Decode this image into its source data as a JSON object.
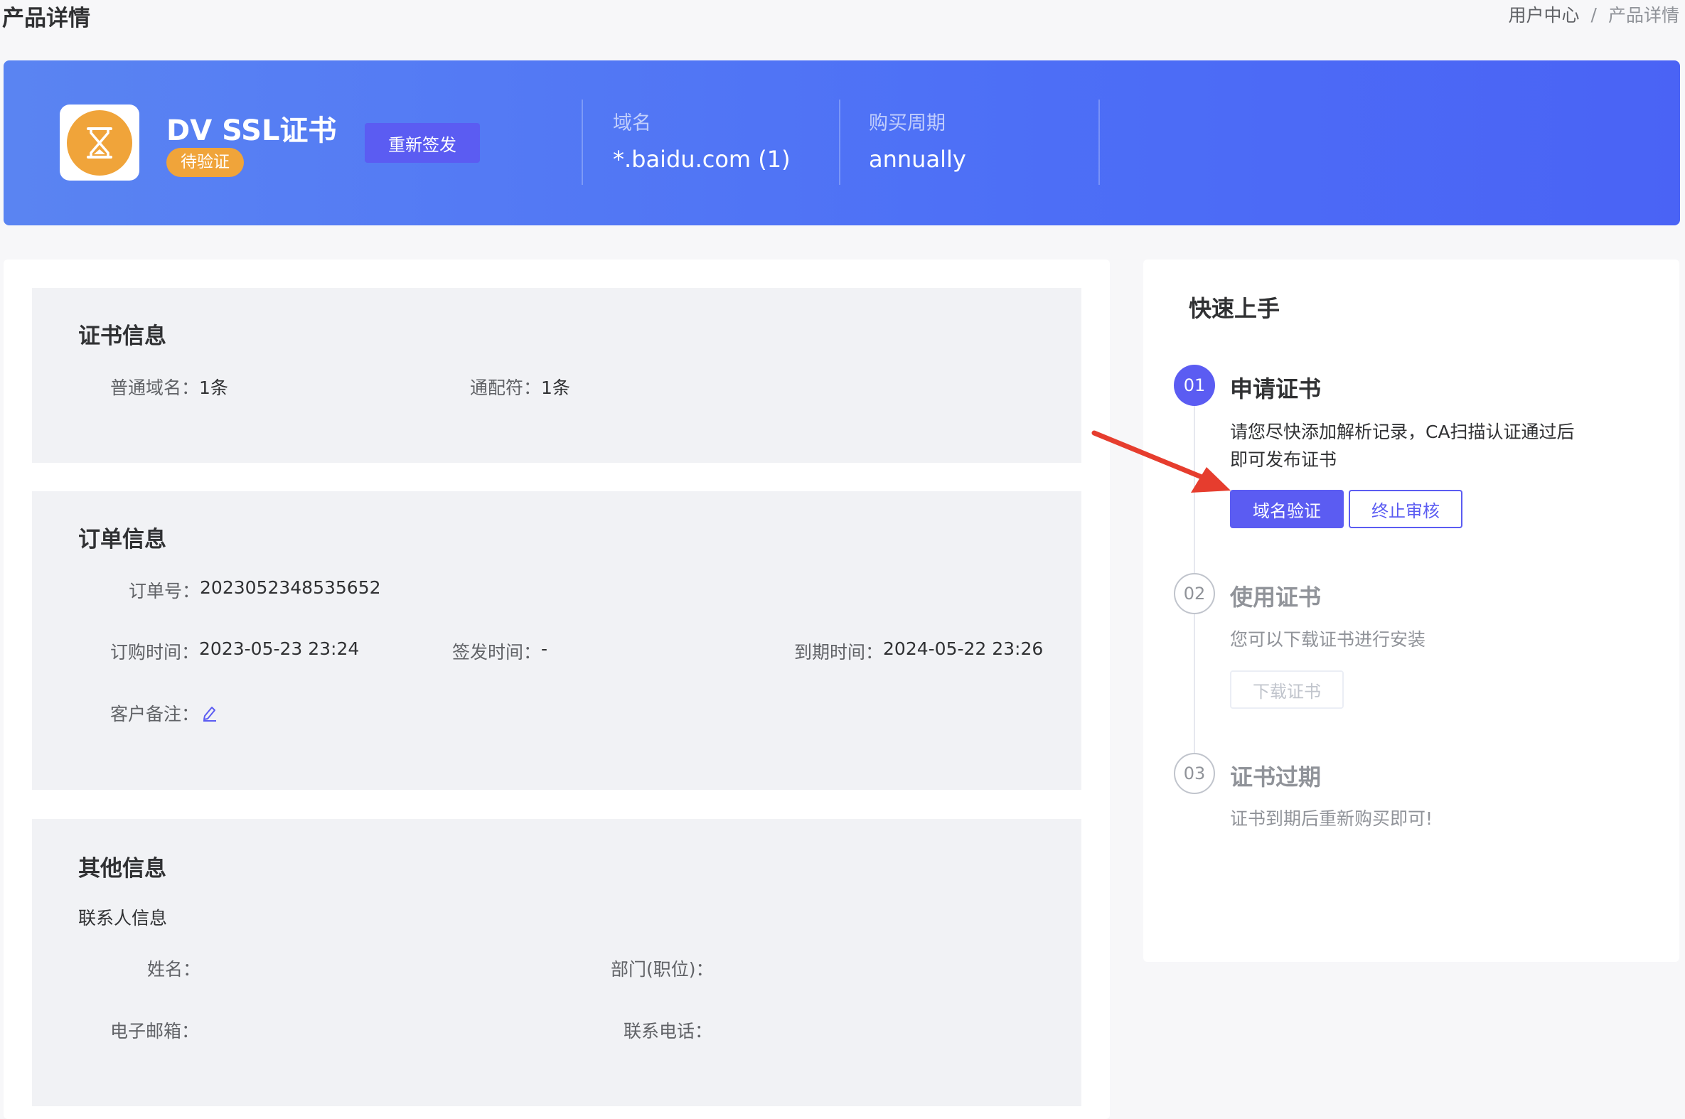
{
  "header": {
    "page_title": "产品详情",
    "breadcrumb": [
      "用户中心",
      "产品详情"
    ],
    "breadcrumb_separator": "/"
  },
  "banner": {
    "icon": "hourglass-icon",
    "product_name": "DV SSL证书",
    "status": "待验证",
    "reissue_button": "重新签发",
    "domain_label": "域名",
    "domain_value": "*.baidu.com (1)",
    "period_label": "购买周期",
    "period_value": "annually",
    "colors": {
      "banner_start": "#5a84f2",
      "banner_end": "#4a63f5",
      "status": "#f0a43a",
      "accent": "#5b5cf2"
    }
  },
  "cert_info": {
    "title": "证书信息",
    "normal_domain_label": "普通域名：",
    "normal_domain_value": "1条",
    "wildcard_label": "通配符：",
    "wildcard_value": "1条"
  },
  "order_info": {
    "title": "订单信息",
    "order_no_label": "订单号：",
    "order_no_value": "2023052348535652",
    "order_time_label": "订购时间：",
    "order_time_value": "2023-05-23 23:24",
    "issue_time_label": "签发时间：",
    "issue_time_value": "-",
    "expire_time_label": "到期时间：",
    "expire_time_value": "2024-05-22 23:26",
    "remark_label": "客户备注："
  },
  "other_info": {
    "title": "其他信息",
    "contact_heading": "联系人信息",
    "name_label": "姓名：",
    "dept_label": "部门(职位)：",
    "email_label": "电子邮箱：",
    "phone_label": "联系电话："
  },
  "quick_start": {
    "title": "快速上手",
    "steps": [
      {
        "num": "01",
        "title": "申请证书",
        "desc_line1": "请您尽快添加解析记录，CA扫描认证通过后",
        "desc_line2": "即可发布证书",
        "btn_primary": "域名验证",
        "btn_secondary": "终止审核"
      },
      {
        "num": "02",
        "title": "使用证书",
        "desc": "您可以下载证书进行安装",
        "btn": "下载证书"
      },
      {
        "num": "03",
        "title": "证书过期",
        "desc": "证书到期后重新购买即可!"
      }
    ]
  }
}
